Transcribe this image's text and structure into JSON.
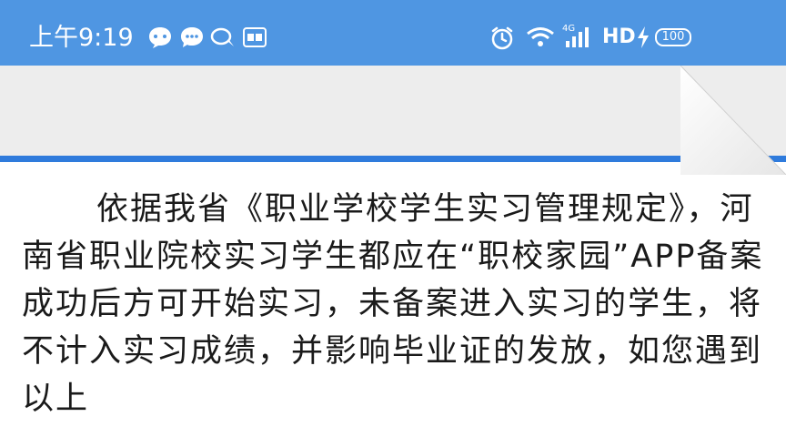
{
  "status_bar": {
    "time": "上午9:19",
    "icons": [
      "chat-bubble-icon",
      "message-icon",
      "speech-icon",
      "app-badge-icon",
      "alarm-icon",
      "wifi-icon",
      "signal-4g-icon",
      "hd-icon",
      "charging-icon",
      "battery-icon"
    ],
    "network_label": "4G",
    "hd_label": "HD",
    "battery_level": "100"
  },
  "article": {
    "paragraph": "依据我省《职业学校学生实习管理规定》，河南省职业院校实习学生都应在“职校家园”APP备案成功后方可开始实习，未备案进入实习的学生，将不计入实习成绩，并影响毕业证的发放，如您遇到以上"
  },
  "colors": {
    "status_bar": "#4f96e2",
    "divider": "#2f7bdc",
    "panel": "#ededed",
    "text": "#1a1a1a"
  }
}
